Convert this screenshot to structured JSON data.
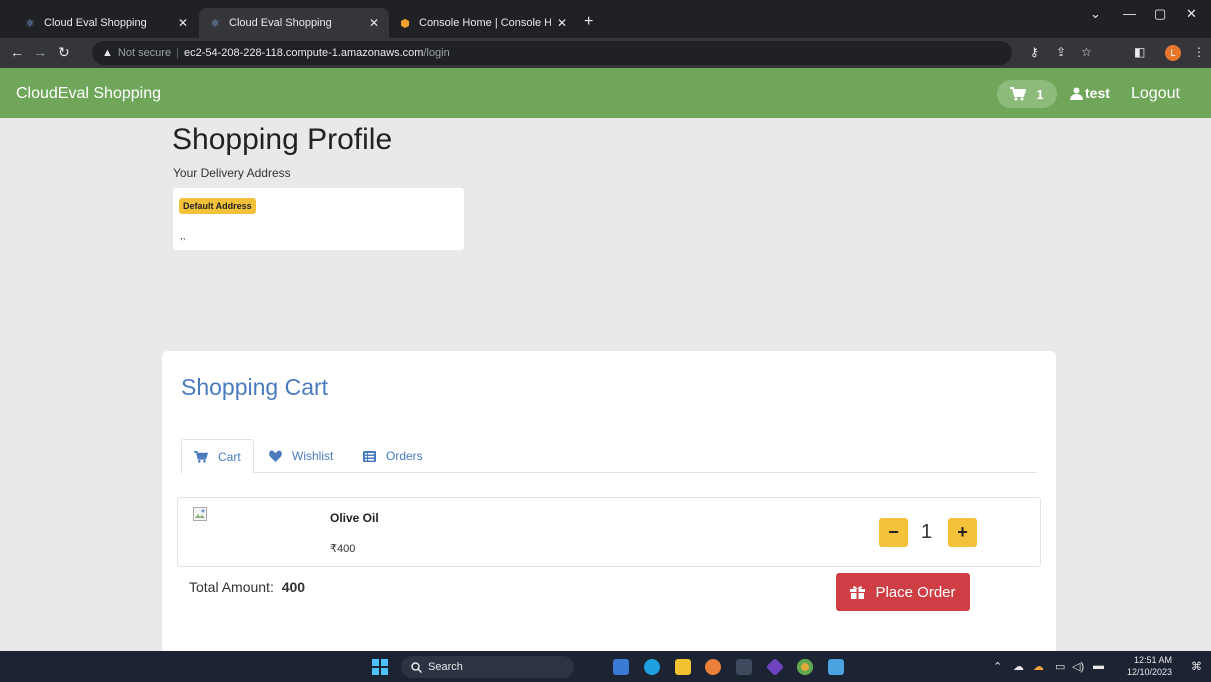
{
  "browser": {
    "tabs": [
      {
        "title": "Cloud Eval Shopping",
        "icon": "react-icon",
        "active": false
      },
      {
        "title": "Cloud Eval Shopping",
        "icon": "react-icon",
        "active": true
      },
      {
        "title": "Console Home | Console Home |",
        "icon": "aws-icon",
        "active": false
      }
    ],
    "security_label": "Not secure",
    "url_host": "ec2-54-208-228-118.compute-1.amazonaws.com",
    "url_path": "/login",
    "profile_initial": "L"
  },
  "header": {
    "brand": "CloudEval Shopping",
    "cart_count": "1",
    "username": "test",
    "logout_label": "Logout",
    "bg_color": "#6fa65a"
  },
  "profile": {
    "title": "Shopping Profile",
    "subtitle": "Your Delivery Address",
    "badge": "Default Address",
    "address_text": ",,"
  },
  "cart": {
    "title": "Shopping Cart",
    "tabs": [
      {
        "label": "Cart",
        "icon": "cart-icon",
        "active": true
      },
      {
        "label": "Wishlist",
        "icon": "heart-icon",
        "active": false
      },
      {
        "label": "Orders",
        "icon": "list-icon",
        "active": false
      }
    ],
    "items": [
      {
        "name": "Olive Oil",
        "price": "₹400",
        "quantity": "1"
      }
    ],
    "total_label": "Total Amount:",
    "total_value": "400",
    "place_order_label": "Place Order",
    "accent_color": "#cf3e45"
  },
  "taskbar": {
    "search_label": "Search",
    "time": "12:51 AM",
    "date": "12/10/2023"
  }
}
